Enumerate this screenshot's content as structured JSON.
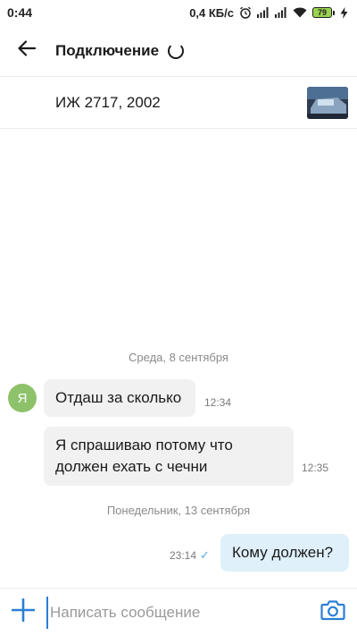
{
  "status_bar": {
    "time": "0:44",
    "net_speed": "0,4 КБ/с",
    "battery_level": "79",
    "icons": [
      "alarm-icon",
      "signal-icon",
      "signal-icon",
      "wifi-icon",
      "battery-icon",
      "charging-icon"
    ]
  },
  "header": {
    "title": "Подключение",
    "back_icon": "arrow-left-icon",
    "loading_icon": "spinner-icon"
  },
  "listing": {
    "title": "ИЖ 2717, 2002",
    "thumbnail_icon": "listing-photo"
  },
  "chat": {
    "sections": [
      {
        "date": "Среда, 8 сентября",
        "messages": [
          {
            "direction": "in",
            "author_initial": "Я",
            "text": "Отдаш за сколько",
            "time": "12:34"
          },
          {
            "direction": "in",
            "text": "Я спрашиваю потому что должен ехать с чечни",
            "time": "12:35"
          }
        ]
      },
      {
        "date": "Понедельник, 13 сентября",
        "messages": [
          {
            "direction": "out",
            "text": "Кому должен?",
            "time": "23:14",
            "status": "sent"
          }
        ]
      }
    ]
  },
  "composer": {
    "placeholder": "Написать сообщение",
    "value": "",
    "add_icon": "plus-icon",
    "camera_icon": "camera-icon"
  },
  "colors": {
    "accent": "#2a7fd4",
    "avatar": "#8dc26a",
    "incoming_bubble": "#f1f1f1",
    "outgoing_bubble": "#dff0fb",
    "battery": "#9ad34d"
  }
}
